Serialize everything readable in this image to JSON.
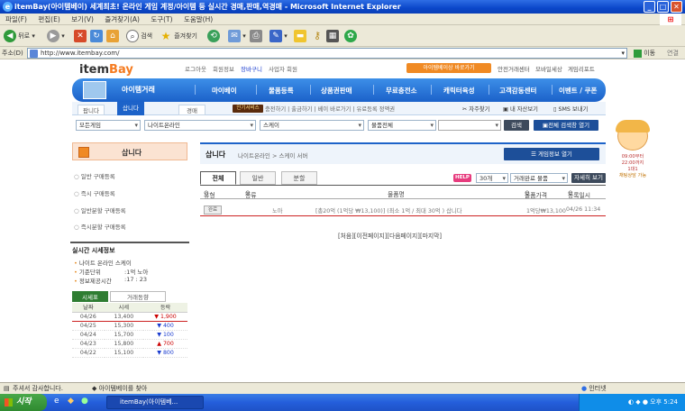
{
  "window": {
    "title": "itemBay(아이템베이) 세계최초! 온라인 게임 계정/아이템 등 실시간 경매,판매,역경매 - Microsoft Internet Explorer",
    "min": "_",
    "max": "□",
    "close": "✕"
  },
  "menubar": [
    "파일(F)",
    "편집(E)",
    "보기(V)",
    "즐겨찾기(A)",
    "도구(T)",
    "도움말(H)"
  ],
  "toolbar": {
    "back": "뒤로",
    "search": "검색",
    "favorites": "즐겨찾기"
  },
  "address": {
    "label": "주소(D)",
    "url": "http://www.itembay.com/",
    "go": "이동",
    "links": "연결"
  },
  "site": {
    "logo_a": "item",
    "logo_b": "Bay",
    "toplinks": [
      "로그아웃",
      "회원정보",
      "장바구니",
      "사업자 회원"
    ],
    "quick": "아이템베이상 바로가기",
    "toplinks2": [
      "안전거래센터",
      "모바일세상",
      "게임리포트"
    ],
    "nav_brand": "아이템거래",
    "nav": [
      "마이베이",
      "물품등록",
      "상품권판매",
      "무료충전소",
      "캐릭터육성",
      "고객감동센터",
      "이벤트 / 쿠폰"
    ],
    "subtabs": [
      "팝니다",
      "삽니다",
      "경매"
    ],
    "popular": "인기서비스",
    "sublinks": "충전하기 | 출금하기 | 베이 바로가기 | 유료등록 정액권",
    "sublinks2": [
      "자주찾기",
      "내 자산보기",
      "SMS 보내기"
    ]
  },
  "filters": {
    "game": "모든게임",
    "server_group": "나이트온라인",
    "server": "스케이",
    "category": "물품전체",
    "search_btn": "검색",
    "all_search": "전체 검색창 열기"
  },
  "left": {
    "title": "삽니다",
    "menu": [
      "일반 구매등록",
      "즉시 구매등록",
      "일반분할 구매등록",
      "즉시분할 구매등록"
    ],
    "rt_title": "실시간 시세정보",
    "rt_game": "나이트 온라인 스케이",
    "rt_unit_label": "기준단위",
    "rt_unit": "1억 노아",
    "rt_time_label": "정보제공시간",
    "rt_time": "17 : 23",
    "rt_tabs": [
      "시세표",
      "거래동향"
    ],
    "rt_cols": [
      "날짜",
      "시세",
      "등락"
    ],
    "rt_rows": [
      {
        "date": "04/26",
        "price": "13,400",
        "change": "▼ 1,900",
        "color": "#c00"
      },
      {
        "date": "04/25",
        "price": "15,300",
        "change": "▼ 400",
        "color": "#1a3ccf"
      },
      {
        "date": "04/24",
        "price": "15,700",
        "change": "▼ 100",
        "color": "#1a3ccf"
      },
      {
        "date": "04/23",
        "price": "15,800",
        "change": "▲ 700",
        "color": "#c00"
      },
      {
        "date": "04/22",
        "price": "15,100",
        "change": "▼ 800",
        "color": "#1a3ccf"
      }
    ]
  },
  "main": {
    "title": "삽니다",
    "breadcrumb": "나이트온라인 > 스케이 서버",
    "open_game": "게임정보 열기",
    "tabs": [
      "전체",
      "일반",
      "분할"
    ],
    "help": "HELP",
    "per_page": "30개",
    "sort": "거래완료 물품",
    "detail": "자세히 보기",
    "cols": [
      "유형",
      "종류",
      "물품명",
      "물품가격",
      "등록일시"
    ],
    "row": {
      "type": "완료",
      "kind": "노아",
      "name": "[총20억 (1억당 ₩13,100)] (최소 1억 / 최대 30억 ) 삽니다",
      "price": "1억당₩13,100",
      "date": "04/26 11:34"
    },
    "pager": "[처음][이전페이지][다음페이지][마지막]"
  },
  "ad": {
    "line1": "09:00부터",
    "line2": "22:00까지",
    "line3": "1대1",
    "line4": "채팅상담 가능"
  },
  "status": {
    "text": "주셔서 감사합니다.",
    "link": "◆ 아이템베이를 찾아",
    "zone": "인터넷"
  },
  "taskbar": {
    "start": "시작",
    "task": "itemBay(아이템베...",
    "clock": "오후 5:24"
  }
}
